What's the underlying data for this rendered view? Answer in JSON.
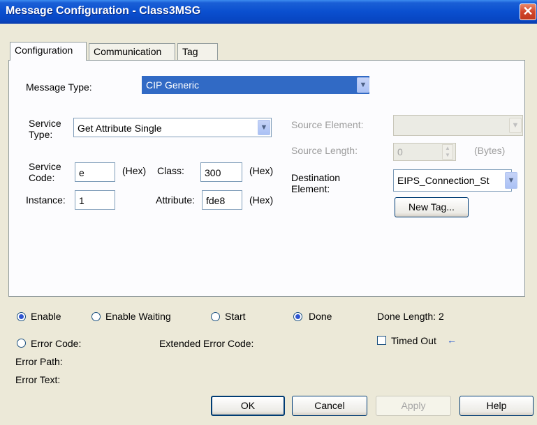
{
  "window": {
    "title": "Message Configuration - Class3MSG",
    "close_glyph": "✕"
  },
  "tabs": [
    {
      "label": "Configuration"
    },
    {
      "label": "Communication"
    },
    {
      "label": "Tag"
    }
  ],
  "config": {
    "message_type_label": "Message Type:",
    "message_type_value": "CIP Generic",
    "service_type_label": "Service\nType:",
    "service_type_value": "Get Attribute Single",
    "service_code_label": "Service\nCode:",
    "service_code_value": "e",
    "hex_label": "(Hex)",
    "class_label": "Class:",
    "class_value": "300",
    "instance_label": "Instance:",
    "instance_value": "1",
    "attribute_label": "Attribute:",
    "attribute_value": "fde8",
    "source_element_label": "Source Element:",
    "source_element_value": "",
    "source_length_label": "Source Length:",
    "source_length_value": "0",
    "bytes_label": "(Bytes)",
    "destination_label": "Destination\nElement:",
    "destination_value": "EIPS_Connection_St",
    "new_tag_button": "New Tag..."
  },
  "status": {
    "enable": "Enable",
    "enable_waiting": "Enable Waiting",
    "start": "Start",
    "done": "Done",
    "done_length": "Done Length: 2",
    "error_code": "Error Code:",
    "extended_error_code": "Extended Error Code:",
    "timed_out": "Timed Out",
    "error_path": "Error Path:",
    "error_text": "Error Text:",
    "enable_checked": true,
    "done_checked": true
  },
  "buttons": {
    "ok": "OK",
    "cancel": "Cancel",
    "apply": "Apply",
    "help": "Help"
  },
  "colors": {
    "titlebar": "#0a4fcf",
    "selection": "#316ac5",
    "dialog_bg": "#ece9d8"
  }
}
